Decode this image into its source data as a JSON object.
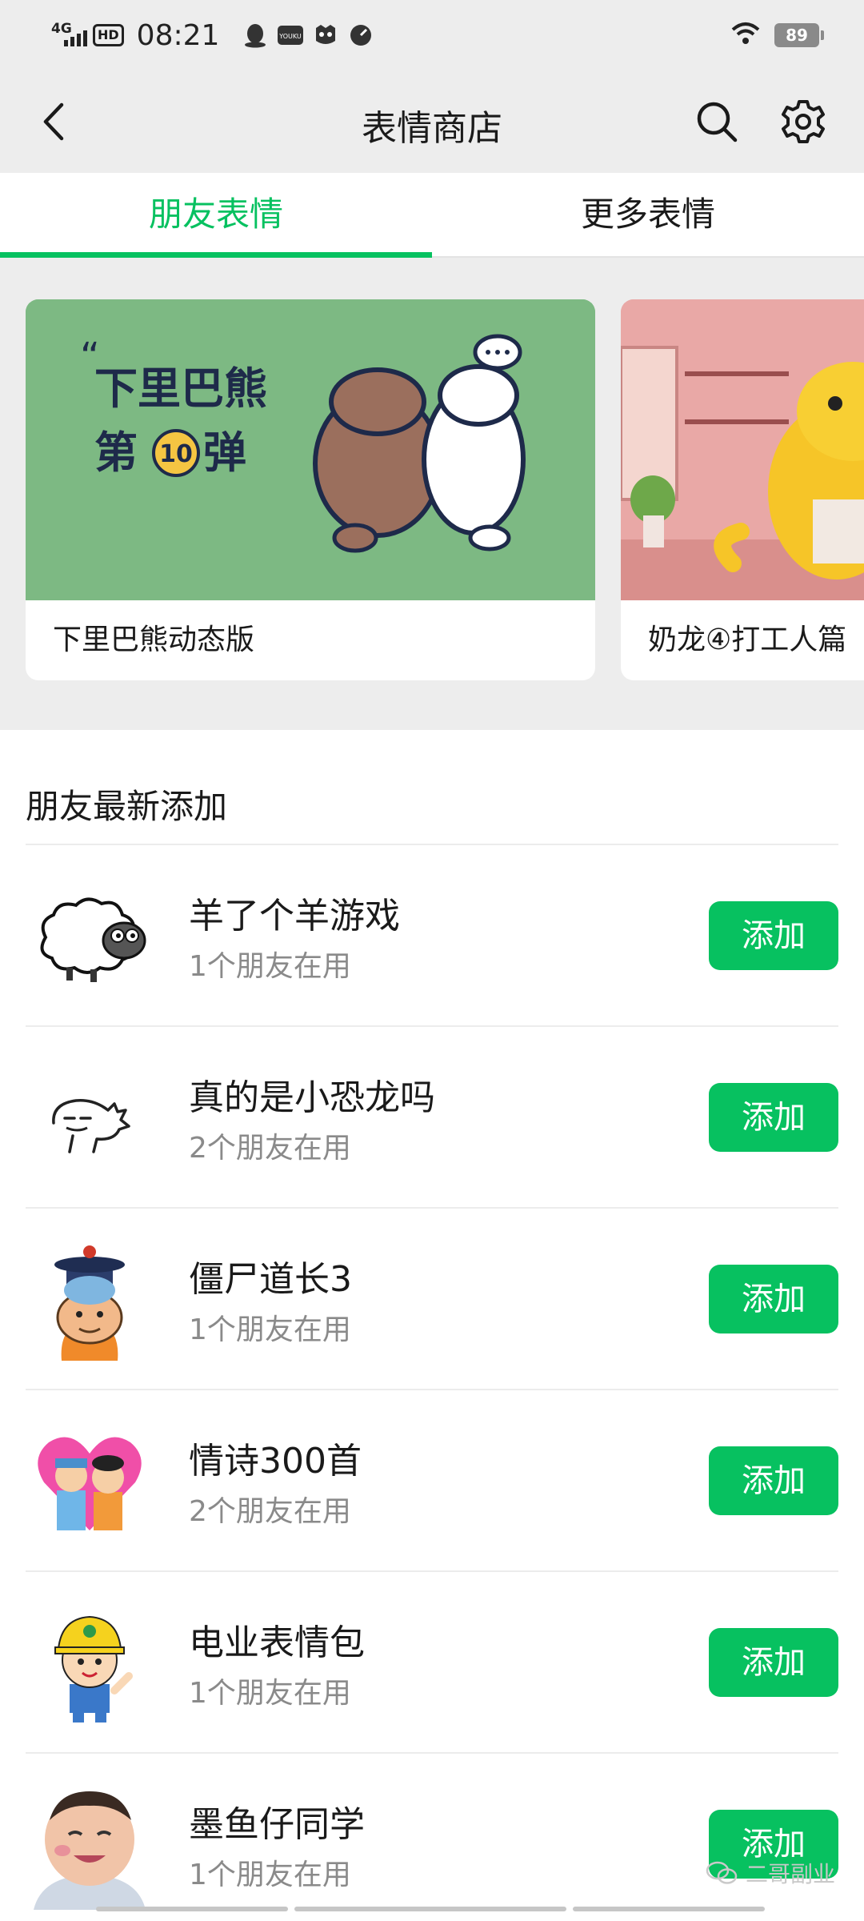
{
  "status_bar": {
    "network": "4G",
    "hd": "HD",
    "time": "08:21",
    "battery": "89",
    "icons": [
      "qq-icon",
      "youku-icon",
      "app-icon",
      "speed-icon",
      "wifi-icon"
    ]
  },
  "nav": {
    "title": "表情商店",
    "back_icon": "back-arrow-icon",
    "search_icon": "search-icon",
    "settings_icon": "gear-icon"
  },
  "tabs": [
    {
      "label": "朋友表情",
      "active": true
    },
    {
      "label": "更多表情",
      "active": false
    }
  ],
  "banners": [
    {
      "label": "下里巴熊动态版",
      "art_text_1": "下里巴熊",
      "art_text_2": "第",
      "art_text_3": "10",
      "art_text_4": "弹"
    },
    {
      "label": "奶龙④打工人篇"
    }
  ],
  "section": {
    "title": "朋友最新添加",
    "items": [
      {
        "name": "羊了个羊游戏",
        "sub": "1个朋友在用",
        "button": "添加",
        "thumb": "sheep-icon"
      },
      {
        "name": "真的是小恐龙吗",
        "sub": "2个朋友在用",
        "button": "添加",
        "thumb": "dinosaur-icon"
      },
      {
        "name": "僵尸道长3",
        "sub": "1个朋友在用",
        "button": "添加",
        "thumb": "zombie-priest-icon"
      },
      {
        "name": "情诗300首",
        "sub": "2个朋友在用",
        "button": "添加",
        "thumb": "couple-heart-icon"
      },
      {
        "name": "电业表情包",
        "sub": "1个朋友在用",
        "button": "添加",
        "thumb": "electrician-icon"
      },
      {
        "name": "墨鱼仔同学",
        "sub": "1个朋友在用",
        "button": "添加",
        "thumb": "baby-photo-icon"
      }
    ]
  },
  "watermark": "二哥副业",
  "colors": {
    "accent": "#07c160",
    "background": "#ededed"
  }
}
